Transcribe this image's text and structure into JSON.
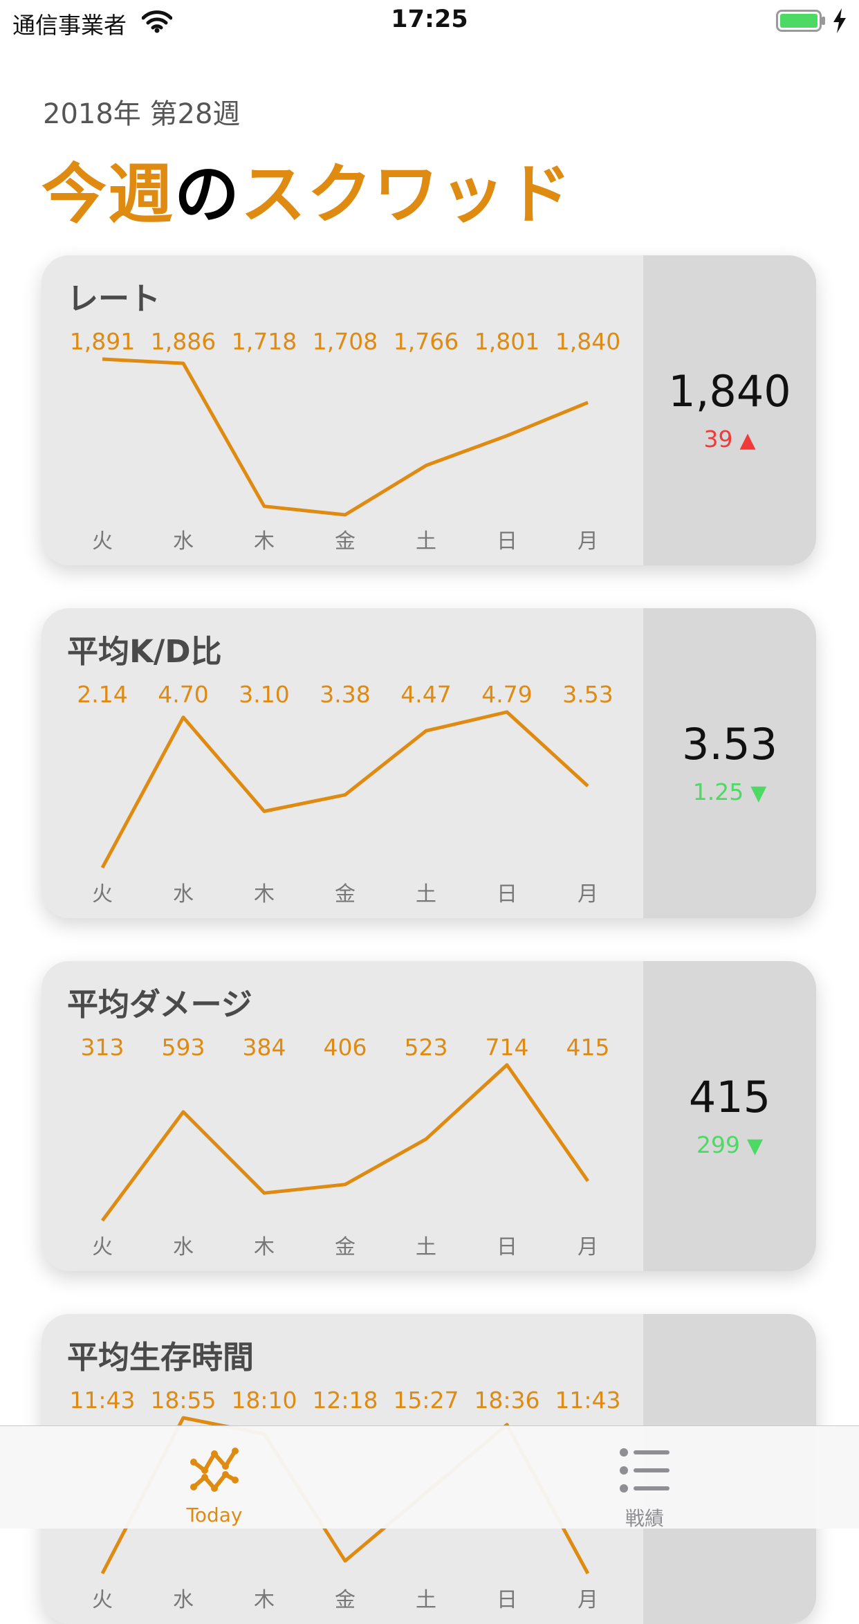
{
  "status_bar": {
    "carrier": "通信事業者",
    "time": "17:25"
  },
  "header": {
    "week": "2018年 第28週",
    "title_1": "今週",
    "title_2": "の",
    "title_3": "スクワッド"
  },
  "colors": {
    "accent": "#df8a10",
    "up": "#f03a3a",
    "down": "#4cd964"
  },
  "cards": [
    {
      "title": "レート",
      "value": "1,840",
      "delta": "39",
      "direction": "up",
      "days": [
        "火",
        "水",
        "木",
        "金",
        "土",
        "日",
        "月"
      ],
      "labels": [
        "1,891",
        "1,886",
        "1,718",
        "1,708",
        "1,766",
        "1,801",
        "1,840"
      ],
      "values": [
        1891,
        1886,
        1718,
        1708,
        1766,
        1801,
        1840
      ]
    },
    {
      "title": "平均K/D比",
      "value": "3.53",
      "delta": "1.25",
      "direction": "down",
      "days": [
        "火",
        "水",
        "木",
        "金",
        "土",
        "日",
        "月"
      ],
      "labels": [
        "2.14",
        "4.70",
        "3.10",
        "3.38",
        "4.47",
        "4.79",
        "3.53"
      ],
      "values": [
        2.14,
        4.7,
        3.1,
        3.38,
        4.47,
        4.79,
        3.53
      ]
    },
    {
      "title": "平均ダメージ",
      "value": "415",
      "delta": "299",
      "direction": "down",
      "days": [
        "火",
        "水",
        "木",
        "金",
        "土",
        "日",
        "月"
      ],
      "labels": [
        "313",
        "593",
        "384",
        "406",
        "523",
        "714",
        "415"
      ],
      "values": [
        313,
        593,
        384,
        406,
        523,
        714,
        415
      ]
    },
    {
      "title": "平均生存時間",
      "value": "",
      "delta": "",
      "direction": "",
      "days": [
        "火",
        "水",
        "木",
        "金",
        "土",
        "日",
        "月"
      ],
      "labels": [
        "11:43",
        "18:55",
        "18:10",
        "12:18",
        "15:27",
        "18:36",
        "11:43"
      ],
      "values": [
        703,
        1135,
        1090,
        738,
        927,
        1116,
        703
      ]
    }
  ],
  "tabbar": {
    "today_label": "Today",
    "record_label": "戦績",
    "today_icon": "trend-icon",
    "record_icon": "list-icon",
    "selected": "today"
  }
}
